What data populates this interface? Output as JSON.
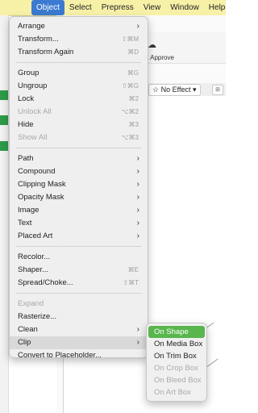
{
  "menubar": {
    "items": [
      "Object",
      "Select",
      "Prepress",
      "View",
      "Window",
      "Help"
    ]
  },
  "background": {
    "approve_label": "& Approve",
    "effect_select": "No Effect"
  },
  "menu": {
    "arrange": "Arrange",
    "transform": "Transform...",
    "transform_sc": "⇧⌘M",
    "transform_again": "Transform Again",
    "transform_again_sc": "⌘D",
    "group": "Group",
    "group_sc": "⌘G",
    "ungroup": "Ungroup",
    "ungroup_sc": "⇧⌘G",
    "lock": "Lock",
    "lock_sc": "⌘2",
    "unlock_all": "Unlock All",
    "unlock_all_sc": "⌥⌘2",
    "hide": "Hide",
    "hide_sc": "⌘3",
    "show_all": "Show All",
    "show_all_sc": "⌥⌘3",
    "path": "Path",
    "compound": "Compound",
    "clipping_mask": "Clipping Mask",
    "opacity_mask": "Opacity Mask",
    "image": "Image",
    "text": "Text",
    "placed_art": "Placed Art",
    "recolor": "Recolor...",
    "shaper": "Shaper...",
    "shaper_sc": "⌘E",
    "spread_choke": "Spread/Choke...",
    "spread_choke_sc": "⇧⌘T",
    "expand": "Expand",
    "rasterize": "Rasterize...",
    "clean": "Clean",
    "clip": "Clip",
    "convert": "Convert to Placeholder..."
  },
  "submenu": {
    "on_shape": "On Shape",
    "on_media_box": "On Media Box",
    "on_trim_box": "On Trim Box",
    "on_crop_box": "On Crop Box",
    "on_bleed_box": "On Bleed Box",
    "on_art_box": "On Art Box"
  },
  "colors": {
    "menubar_bg": "#f7f1a8",
    "active_menu": "#3b7ad0",
    "submenu_selected": "#58b64d"
  }
}
